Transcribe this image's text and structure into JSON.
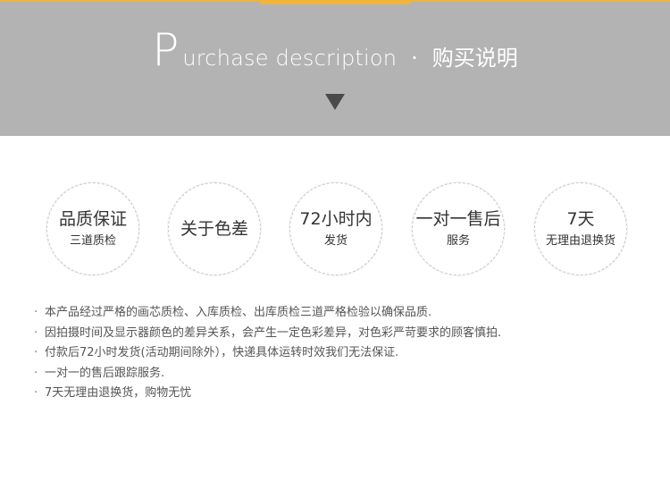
{
  "header": {
    "title_initial": "P",
    "title_rest": "urchase description",
    "separator": "·",
    "title_cn": "购买说明",
    "accent_color": "#f0b43c",
    "banner_color": "#b3b3b3"
  },
  "features": [
    {
      "title": "品质保证",
      "subtitle": "三道质检"
    },
    {
      "title": "关于色差",
      "subtitle": ""
    },
    {
      "title": "72小时内",
      "subtitle": "发货"
    },
    {
      "title": "一对一售后",
      "subtitle": "服务"
    },
    {
      "title": "7天",
      "subtitle": "无理由退换货"
    }
  ],
  "descriptions": [
    "本产品经过严格的画芯质检、入库质检、出库质检三道严格检验以确保品质.",
    "因拍摄时间及显示器颜色的差异关系，会产生一定色彩差异，对色彩严苛要求的顾客慎拍.",
    "付款后72小时发货(活动期间除外），快递具体运转时效我们无法保证.",
    "一对一的售后跟踪服务.",
    "7天无理由退换货，购物无忧"
  ],
  "bullet": "·"
}
